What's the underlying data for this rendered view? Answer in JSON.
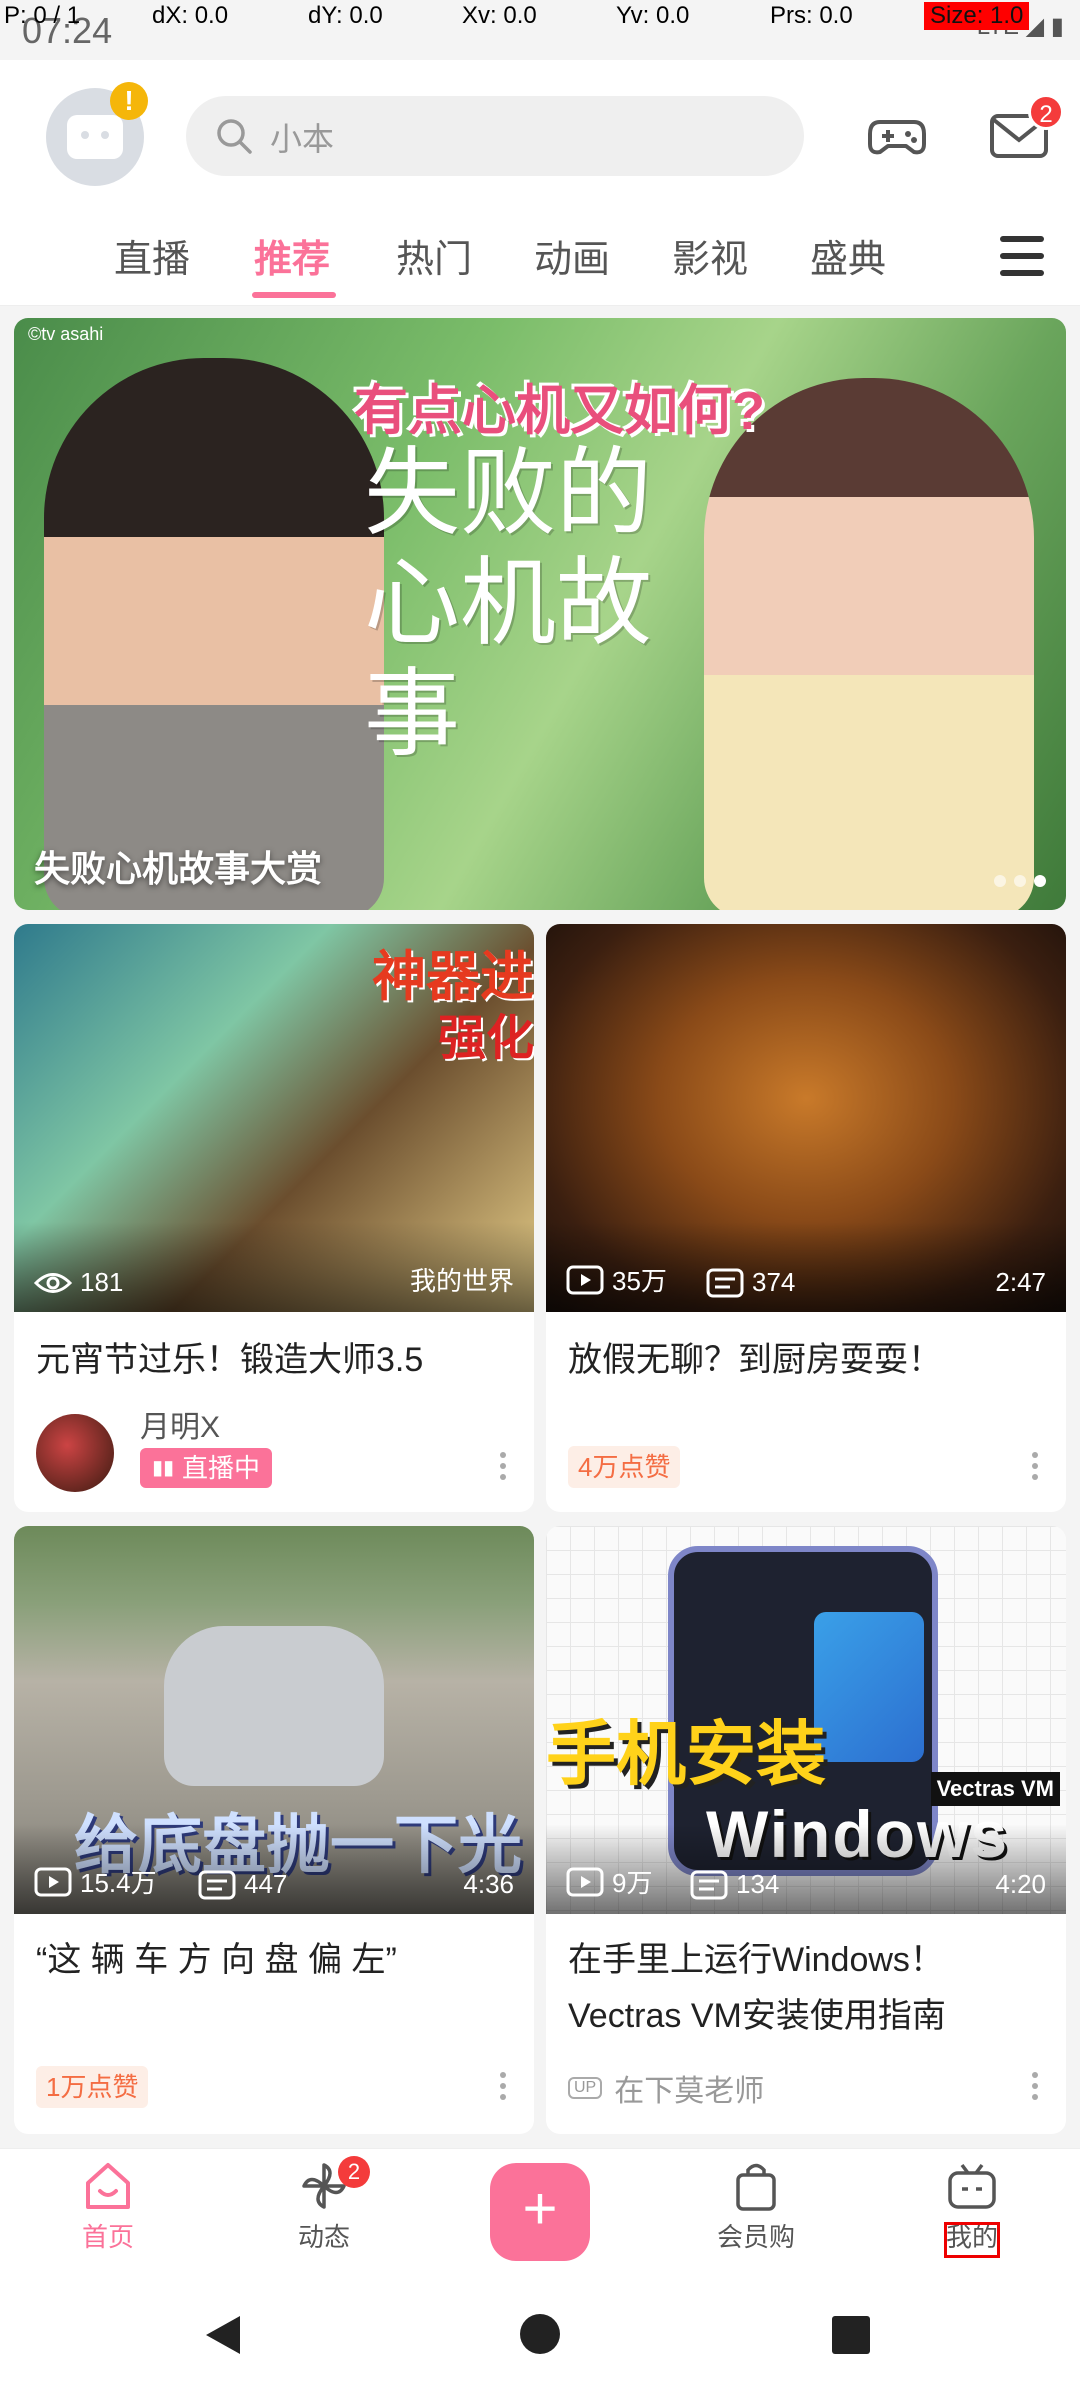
{
  "debug": {
    "p": "P: 0 / 1",
    "dx": "dX: 0.0",
    "dy": "dY: 0.0",
    "xv": "Xv: 0.0",
    "yv": "Yv: 0.0",
    "prs": "Prs: 0.0",
    "size": "Size: 1.0"
  },
  "status": {
    "time": "07:24",
    "network": "LTE"
  },
  "header": {
    "search_placeholder": "小本",
    "mail_badge": "2",
    "avatar_alert": "!"
  },
  "tabs": [
    "直播",
    "推荐",
    "热门",
    "动画",
    "影视",
    "盛典"
  ],
  "active_tab": "推荐",
  "banner": {
    "caption": "失败心机故事大赏",
    "credit": "©tv asahi",
    "overlay_line1": "有点心机又如何?",
    "overlay_line2": "失败的心机故事",
    "dots": 3,
    "active_dot": 3
  },
  "cards": [
    {
      "views": "181",
      "overlay_tag": "我的世界",
      "title": "元宵节过乐！锻造大师3.5",
      "author": "月明X",
      "live_label": "直播中",
      "thumb_text_1": "神器进",
      "thumb_text_2": "强化"
    },
    {
      "views": "35万",
      "comments": "374",
      "duration": "2:47",
      "title": "放假无聊？到厨房耍耍！",
      "likes": "4万点赞"
    },
    {
      "views": "15.4万",
      "comments": "447",
      "duration": "4:36",
      "title": "“这 辆 车 方 向 盘 偏 左”",
      "likes": "1万点赞",
      "thumb_text": "给底盘抛一下光"
    },
    {
      "views": "9万",
      "comments": "134",
      "duration": "4:20",
      "title": "在手里上运行Windows！Vectras VM安装使用指南",
      "uploader": "在下莫老师",
      "up_label": "UP",
      "thumb_text_big": "手机安装",
      "thumb_text_win": "Windows",
      "thumb_text_vm": "Vectras VM"
    }
  ],
  "bottom_nav": {
    "home": "首页",
    "dynamic": "动态",
    "dynamic_badge": "2",
    "plus": "+",
    "shop": "会员购",
    "mine": "我的"
  },
  "colors": {
    "accent": "#fb7299",
    "badge_red": "#f43b3b",
    "likes": "#f46d43"
  }
}
